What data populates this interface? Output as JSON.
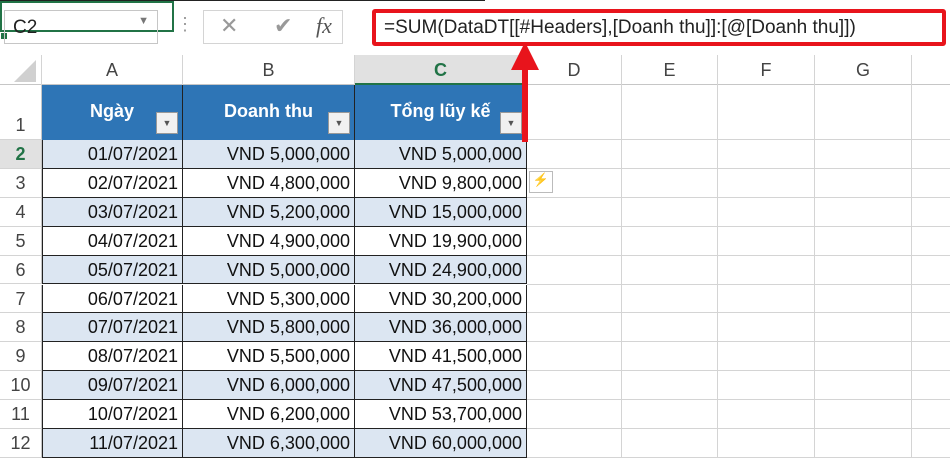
{
  "name_box": "C2",
  "formula": "=SUM(DataDT[[#Headers],[Doanh thu]]:[@[Doanh thu]])",
  "fx_label": "fx",
  "columns": [
    "A",
    "B",
    "C",
    "D",
    "E",
    "F",
    "G"
  ],
  "row_numbers": [
    "1",
    "2",
    "3",
    "4",
    "5",
    "6",
    "7",
    "8",
    "9",
    "10",
    "11",
    "12"
  ],
  "table": {
    "headers": [
      "Ngày",
      "Doanh thu",
      "Tổng lũy kế"
    ],
    "rows": [
      [
        "01/07/2021",
        "VND 5,000,000",
        "VND 5,000,000"
      ],
      [
        "02/07/2021",
        "VND 4,800,000",
        "VND 9,800,000"
      ],
      [
        "03/07/2021",
        "VND 5,200,000",
        "VND 15,000,000"
      ],
      [
        "04/07/2021",
        "VND 4,900,000",
        "VND 19,900,000"
      ],
      [
        "05/07/2021",
        "VND 5,000,000",
        "VND 24,900,000"
      ],
      [
        "06/07/2021",
        "VND 5,300,000",
        "VND 30,200,000"
      ],
      [
        "07/07/2021",
        "VND 5,800,000",
        "VND 36,000,000"
      ],
      [
        "08/07/2021",
        "VND 5,500,000",
        "VND 41,500,000"
      ],
      [
        "09/07/2021",
        "VND 6,000,000",
        "VND 47,500,000"
      ],
      [
        "10/07/2021",
        "VND 6,200,000",
        "VND 53,700,000"
      ],
      [
        "11/07/2021",
        "VND 6,300,000",
        "VND 60,000,000"
      ]
    ]
  },
  "colors": {
    "header": "#2e75b6",
    "band": "#dce6f2",
    "highlight": "#e8141c",
    "selection": "#217346"
  }
}
